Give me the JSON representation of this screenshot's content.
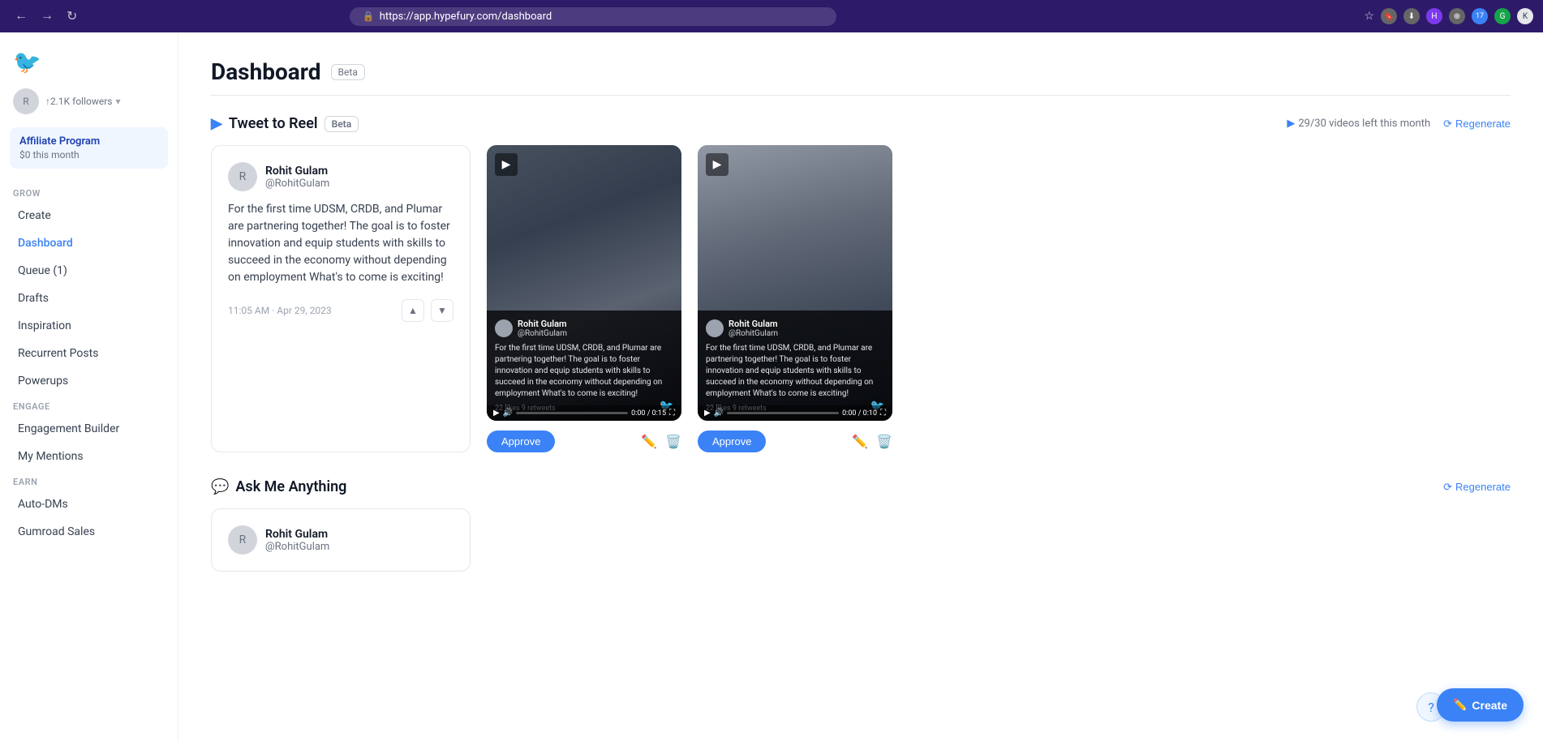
{
  "browser": {
    "url": "https://app.hypefury.com/dashboard",
    "back_label": "←",
    "forward_label": "→",
    "refresh_label": "↻"
  },
  "sidebar": {
    "logo_icon": "🐦",
    "user": {
      "name": "Rohit Gulam",
      "handle": "@RohitGulam",
      "followers": "↑2.1K followers"
    },
    "affiliate": {
      "title": "Affiliate Program",
      "subtitle": "$0 this month"
    },
    "grow_label": "GROW",
    "items_grow": [
      {
        "id": "create",
        "label": "Create",
        "active": false
      },
      {
        "id": "dashboard",
        "label": "Dashboard",
        "active": true
      },
      {
        "id": "queue",
        "label": "Queue (1)",
        "active": false
      },
      {
        "id": "drafts",
        "label": "Drafts",
        "active": false
      },
      {
        "id": "inspiration",
        "label": "Inspiration",
        "active": false
      },
      {
        "id": "recurrent-posts",
        "label": "Recurrent Posts",
        "active": false
      },
      {
        "id": "powerups",
        "label": "Powerups",
        "active": false
      }
    ],
    "engage_label": "ENGAGE",
    "items_engage": [
      {
        "id": "engagement-builder",
        "label": "Engagement Builder",
        "active": false
      },
      {
        "id": "my-mentions",
        "label": "My Mentions",
        "active": false
      }
    ],
    "earn_label": "EARN",
    "items_earn": [
      {
        "id": "auto-dms",
        "label": "Auto-DMs",
        "active": false
      },
      {
        "id": "gumroad-sales",
        "label": "Gumroad Sales",
        "active": false
      }
    ]
  },
  "page": {
    "title": "Dashboard",
    "beta_badge": "Beta"
  },
  "tweet_to_reel": {
    "title": "Tweet to Reel",
    "beta_badge": "Beta",
    "videos_left": "29/30 videos left this month",
    "regenerate": "Regenerate",
    "tweet": {
      "author": "Rohit Gulam",
      "handle": "@RohitGulam",
      "content": "For the first time UDSM, CRDB, and Plumar are partnering together! The goal is to foster innovation and equip students with skills to succeed in the economy without depending on employment What's to come is exciting!",
      "timestamp": "11:05 AM · Apr 29, 2023"
    },
    "videos": [
      {
        "id": "video1",
        "duration": "0:00 / 0:15",
        "approve_label": "Approve",
        "tweet_text": "For the first time UDSM, CRDB, and Plumar are partnering together! The goal is to foster innovation and equip students with skills to succeed in the economy without depending on employment What's to come is exciting!",
        "stats": "22 likes  9 retweets"
      },
      {
        "id": "video2",
        "duration": "0:00 / 0:10",
        "approve_label": "Approve",
        "tweet_text": "For the first time UDSM, CRDB, and Plumar are partnering together! The goal is to foster innovation and equip students with skills to succeed in the economy without depending on employment What's to come is exciting!",
        "stats": "22 likes  9 retweets"
      }
    ]
  },
  "ask_me_anything": {
    "title": "Ask Me Anything",
    "regenerate": "Regenerate"
  },
  "floating": {
    "create_label": "Create",
    "help_label": "?"
  }
}
